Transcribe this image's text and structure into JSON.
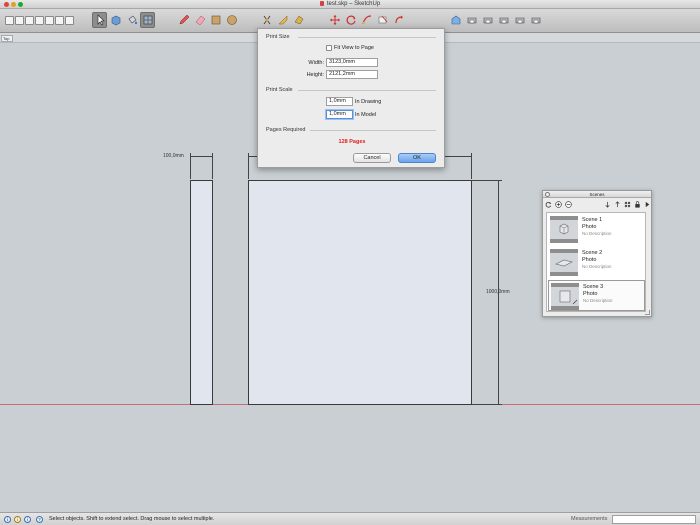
{
  "window": {
    "title": "test.skp – SketchUp"
  },
  "tabs": {
    "active_scene_label": "Top"
  },
  "toolbar": {
    "groups": [
      "views",
      "select-tools",
      "draw-tools",
      "modify-tools",
      "camera-tools",
      "standard-views"
    ]
  },
  "print_dialog": {
    "print_size_title": "Print Size",
    "fit_view_label": "Fit View to Page",
    "fit_view_checked": false,
    "width_label": "Width:",
    "width_value": "3123,0mm",
    "height_label": "Height:",
    "height_value": "2121,2mm",
    "print_scale_title": "Print Scale",
    "drawing_value": "1,0mm",
    "drawing_label": "In Drawing",
    "model_value": "1,0mm",
    "model_label": "In Model",
    "pages_required_title": "Pages Required",
    "pages_required_value": "128 Pages",
    "cancel_label": "Cancel",
    "ok_label": "OK"
  },
  "canvas": {
    "dimension_narrow": "100,0mm",
    "dimension_height": "1000,0mm",
    "ground_color": "#c76f78",
    "face_color": "#e1e5ee"
  },
  "scenes_panel": {
    "title": "Scenes",
    "items": [
      {
        "name": "Scene 1",
        "style": "Photo",
        "description": "No Description",
        "selected": false
      },
      {
        "name": "Scene 2",
        "style": "Photo",
        "description": "No Description",
        "selected": false
      },
      {
        "name": "Scene 3",
        "style": "Photo",
        "description": "No Description",
        "selected": true
      }
    ]
  },
  "statusbar": {
    "message": "Select objects. Shift to extend select. Drag mouse to select multiple.",
    "measurements_label": "Measurements",
    "measurements_value": ""
  }
}
